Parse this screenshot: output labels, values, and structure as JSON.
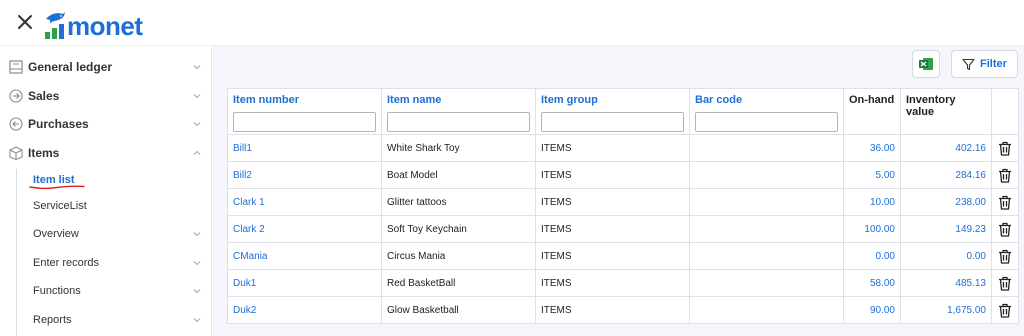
{
  "app": {
    "logo_text": "monet",
    "brand_color": "#1d6fd6"
  },
  "sidebar": {
    "items": [
      {
        "label": "General ledger",
        "icon": "ledger-icon"
      },
      {
        "label": "Sales",
        "icon": "arrow-right-circle-icon"
      },
      {
        "label": "Purchases",
        "icon": "arrow-left-circle-icon"
      },
      {
        "label": "Items",
        "icon": "box-icon"
      }
    ],
    "sub_items": [
      {
        "label": "Item list",
        "active": true
      },
      {
        "label": "ServiceList"
      },
      {
        "label": "Overview"
      },
      {
        "label": "Enter records"
      },
      {
        "label": "Functions"
      },
      {
        "label": "Reports"
      }
    ]
  },
  "toolbar": {
    "filter_label": "Filter",
    "excel_icon": "excel-icon"
  },
  "table": {
    "columns": [
      "Item number",
      "Item name",
      "Item group",
      "Bar code",
      "On-hand",
      "Inventory value"
    ],
    "rows": [
      {
        "number": "Bill1",
        "name": "White Shark Toy",
        "group": "ITEMS",
        "barcode": "",
        "onhand": "36.00",
        "value": "402.16"
      },
      {
        "number": "Bill2",
        "name": "Boat Model",
        "group": "ITEMS",
        "barcode": "",
        "onhand": "5.00",
        "value": "284.16"
      },
      {
        "number": "Clark 1",
        "name": "Glitter tattoos",
        "group": "ITEMS",
        "barcode": "",
        "onhand": "10.00",
        "value": "238.00"
      },
      {
        "number": "Clark 2",
        "name": "Soft Toy Keychain",
        "group": "ITEMS",
        "barcode": "",
        "onhand": "100.00",
        "value": "149.23"
      },
      {
        "number": "CMania",
        "name": "Circus Mania",
        "group": "ITEMS",
        "barcode": "",
        "onhand": "0.00",
        "value": "0.00"
      },
      {
        "number": "Duk1",
        "name": "Red BasketBall",
        "group": "ITEMS",
        "barcode": "",
        "onhand": "58.00",
        "value": "485.13"
      },
      {
        "number": "Duk2",
        "name": "Glow Basketball",
        "group": "ITEMS",
        "barcode": "",
        "onhand": "90.00",
        "value": "1,675.00"
      }
    ]
  }
}
